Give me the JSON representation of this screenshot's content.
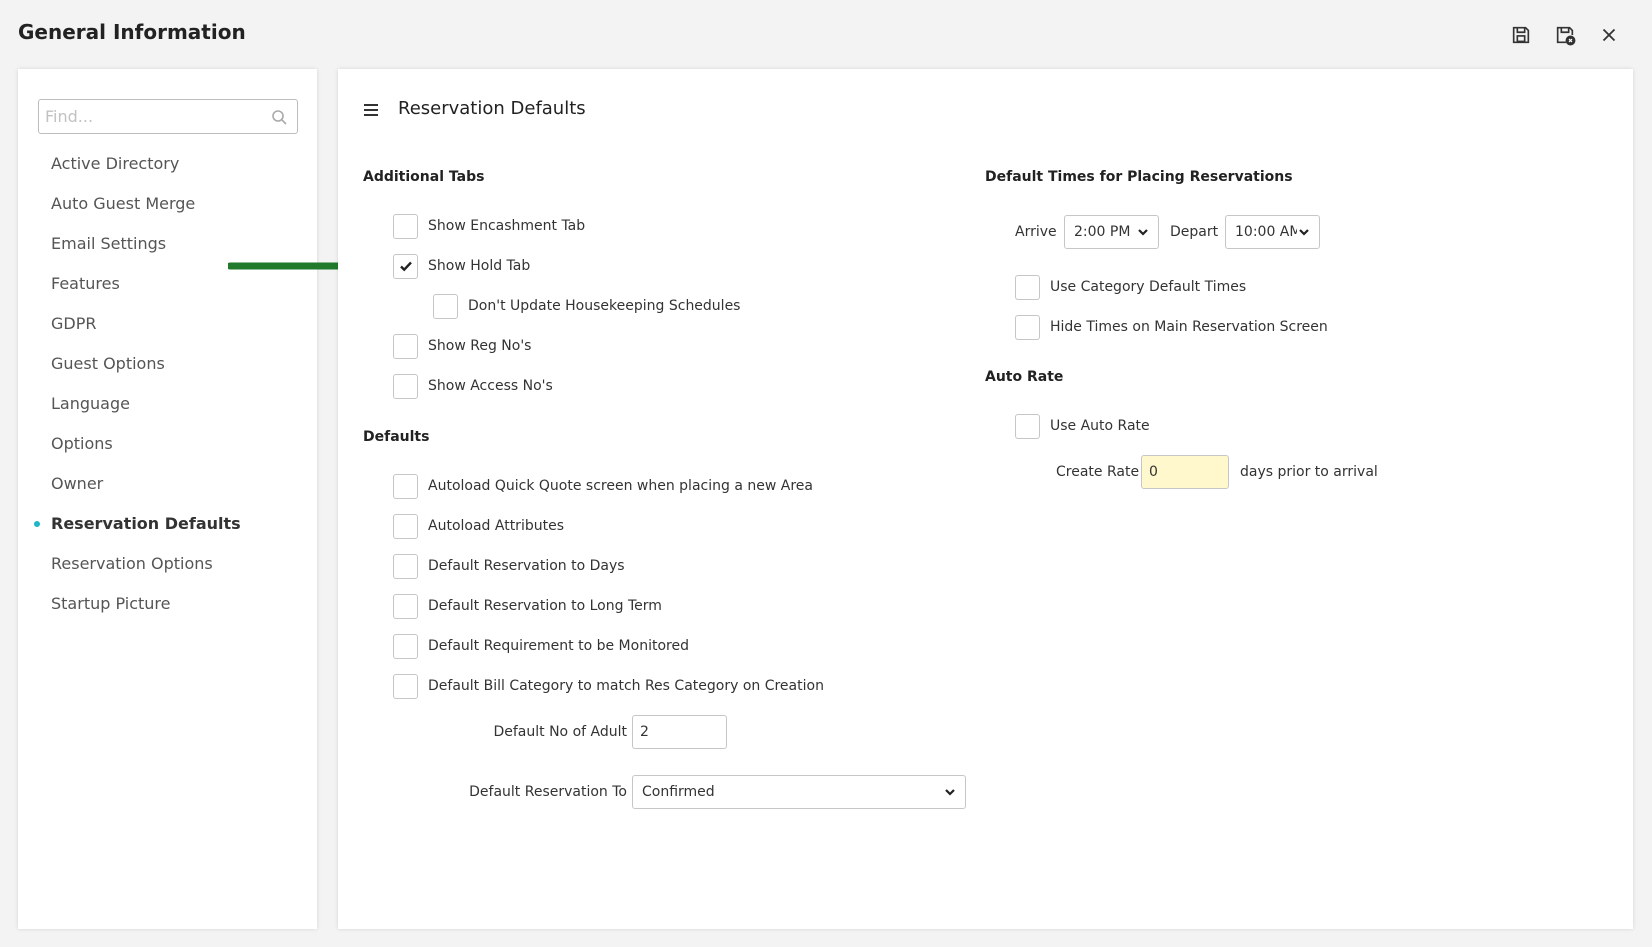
{
  "window": {
    "title": "General Information",
    "actions": [
      {
        "icon": "save-icon"
      },
      {
        "icon": "save-close-icon"
      },
      {
        "icon": "close-icon"
      }
    ]
  },
  "sidebar": {
    "search_placeholder": "Find...",
    "items": [
      {
        "label": "Active Directory",
        "active": false
      },
      {
        "label": "Auto Guest Merge",
        "active": false
      },
      {
        "label": "Email Settings",
        "active": false
      },
      {
        "label": "Features",
        "active": false
      },
      {
        "label": "GDPR",
        "active": false
      },
      {
        "label": "Guest Options",
        "active": false
      },
      {
        "label": "Language",
        "active": false
      },
      {
        "label": "Options",
        "active": false
      },
      {
        "label": "Owner",
        "active": false
      },
      {
        "label": "Reservation Defaults",
        "active": true
      },
      {
        "label": "Reservation Options",
        "active": false
      },
      {
        "label": "Startup Picture",
        "active": false
      }
    ],
    "active_color": "#1fb6c9"
  },
  "main": {
    "title": "Reservation Defaults",
    "additional_tabs": {
      "heading": "Additional Tabs",
      "show_encashment_tab": {
        "label": "Show Encashment Tab",
        "checked": false
      },
      "show_hold_tab": {
        "label": "Show Hold Tab",
        "checked": true
      },
      "dont_update_housekeeping": {
        "label": "Don't Update Housekeeping Schedules",
        "checked": false
      },
      "show_reg_nos": {
        "label": "Show Reg No's",
        "checked": false
      },
      "show_access_nos": {
        "label": "Show Access No's",
        "checked": false
      }
    },
    "defaults": {
      "heading": "Defaults",
      "autoload_quick_quote": {
        "label": "Autoload Quick Quote screen when placing a new Area",
        "checked": false
      },
      "autoload_attributes": {
        "label": "Autoload Attributes",
        "checked": false
      },
      "default_res_days": {
        "label": "Default Reservation to Days",
        "checked": false
      },
      "default_res_long_term": {
        "label": "Default Reservation to Long Term",
        "checked": false
      },
      "default_requirement_monitored": {
        "label": "Default Requirement to be Monitored",
        "checked": false
      },
      "default_bill_category": {
        "label": "Default Bill Category to match Res Category on Creation",
        "checked": false
      },
      "default_no_adult": {
        "label": "Default No of Adult",
        "value": "2"
      },
      "default_reservation_to": {
        "label": "Default Reservation To",
        "value": "Confirmed"
      }
    },
    "default_times": {
      "heading": "Default Times for Placing Reservations",
      "arrive_label": "Arrive",
      "arrive_value": "2:00 PM",
      "depart_label": "Depart",
      "depart_value": "10:00 AM",
      "use_category_default_times": {
        "label": "Use Category Default Times",
        "checked": false
      },
      "hide_times_main_screen": {
        "label": "Hide Times on Main Reservation Screen",
        "checked": false
      }
    },
    "auto_rate": {
      "heading": "Auto Rate",
      "use_auto_rate": {
        "label": "Use Auto Rate",
        "checked": false
      },
      "create_rate_label": "Create Rate",
      "create_rate_value": "0",
      "create_rate_suffix": "days prior to arrival"
    }
  },
  "annotation": {
    "arrow_color": "#217a2b"
  }
}
